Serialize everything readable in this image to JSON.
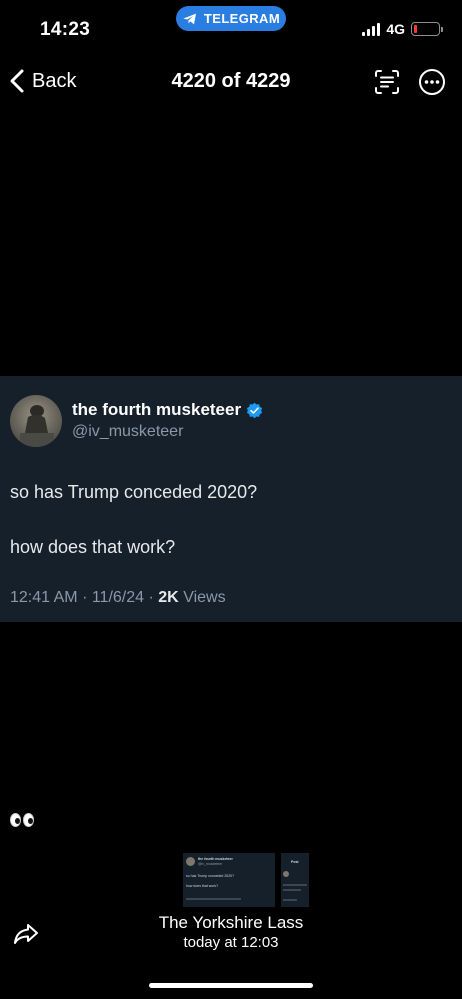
{
  "status_bar": {
    "time": "14:23",
    "return_app": "TELEGRAM",
    "network": "4G",
    "battery_level": 0.15,
    "battery_color": "#ff3b30",
    "accent": "#2a7de1"
  },
  "nav": {
    "back_label": "Back",
    "title": "4220 of 4229",
    "icons": [
      "chevron-left-icon",
      "text-recognition-icon",
      "more-icon"
    ]
  },
  "tweet": {
    "display_name": "the fourth musketeer",
    "handle": "@iv_musketeer",
    "line1": "so has Trump conceded 2020?",
    "line2": "how does that work?",
    "time": "12:41 AM",
    "date": "11/6/24",
    "views_count": "2K",
    "views_label": "Views",
    "card_color": "#15202b",
    "verified_color": "#1d9bf0"
  },
  "caption": {
    "emoji": "eyes-emoji"
  },
  "thumbnails": {
    "main": {
      "name": "the fourth musketeer",
      "handle": "@iv_musketeer",
      "line1": "so has Trump conceded 2020?",
      "line2": "how does that work?"
    },
    "next": {
      "title": "Post"
    }
  },
  "footer": {
    "sender": "The Yorkshire Lass",
    "date": "today at 12:03"
  }
}
